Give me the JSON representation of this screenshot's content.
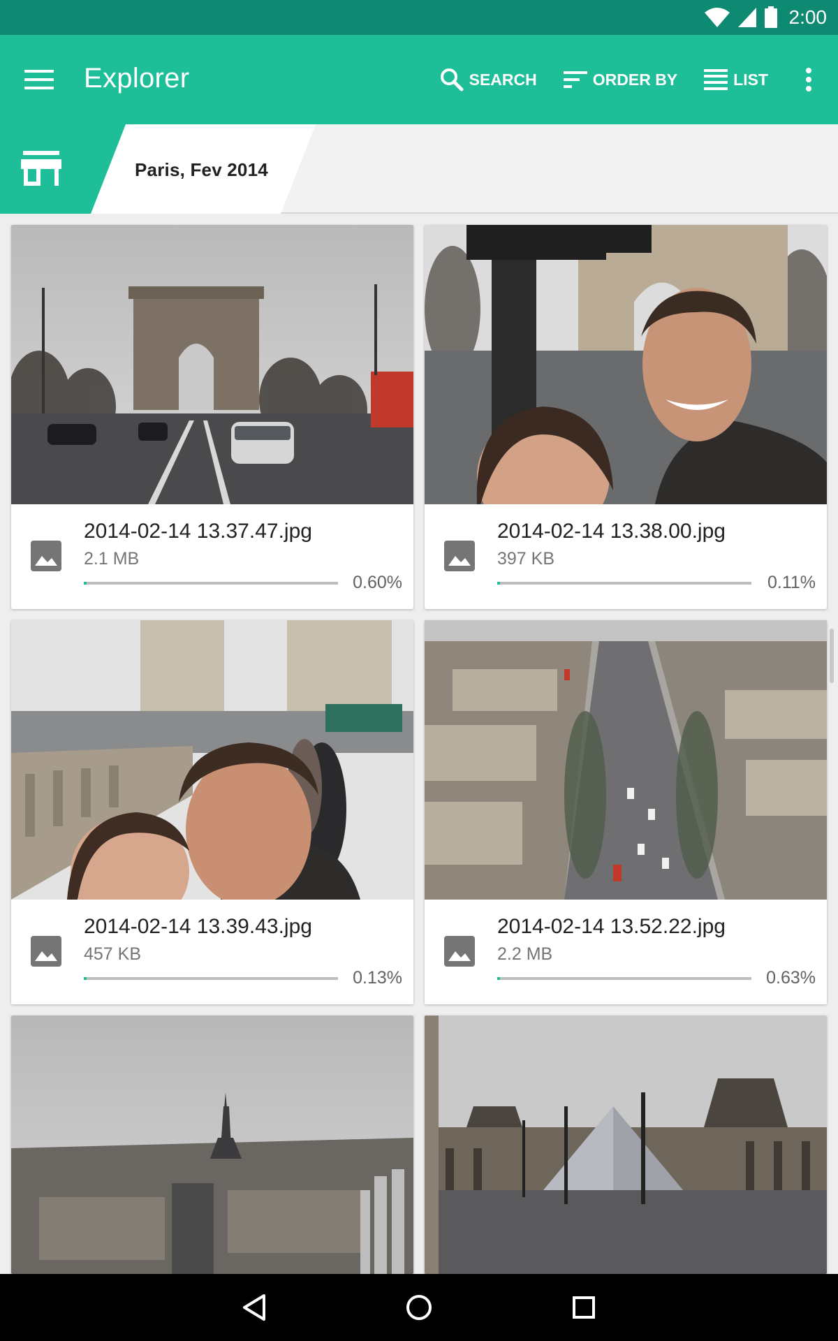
{
  "status_bar": {
    "time": "2:00",
    "icons": [
      "wifi-icon",
      "signal-icon",
      "battery-icon"
    ]
  },
  "app_bar": {
    "title": "Explorer",
    "actions": [
      {
        "label": "SEARCH",
        "icon": "search-icon"
      },
      {
        "label": "ORDER BY",
        "icon": "sort-icon"
      },
      {
        "label": "LIST",
        "icon": "list-icon"
      }
    ]
  },
  "breadcrumb": {
    "home_icon": "storefront-icon",
    "current": "Paris, Fev 2014"
  },
  "files": [
    {
      "name": "2014-02-14 13.37.47.jpg",
      "size": "2.1 MB",
      "percent_label": "0.60%",
      "percent": 0.6,
      "scene": "Arc de Triomphe street view"
    },
    {
      "name": "2014-02-14 13.38.00.jpg",
      "size": "397 KB",
      "percent_label": "0.11%",
      "percent": 0.11,
      "scene": "selfie at Arc de Triomphe"
    },
    {
      "name": "2014-02-14 13.39.43.jpg",
      "size": "457 KB",
      "percent_label": "0.13%",
      "percent": 0.13,
      "scene": "selfie near balustrade"
    },
    {
      "name": "2014-02-14 13.52.22.jpg",
      "size": "2.2 MB",
      "percent_label": "0.63%",
      "percent": 0.63,
      "scene": "Champs-Elysees aerial view"
    },
    {
      "name": "",
      "size": "",
      "percent_label": "",
      "percent": 0,
      "scene": "Eiffel Tower skyline"
    },
    {
      "name": "",
      "size": "",
      "percent_label": "",
      "percent": 0,
      "scene": "Louvre pyramid"
    }
  ],
  "colors": {
    "primary": "#1dbe98",
    "primary_dark": "#0f8a72",
    "background": "#eeeeee"
  },
  "nav_bar": {
    "buttons": [
      "back-icon",
      "home-icon",
      "recents-icon"
    ]
  }
}
